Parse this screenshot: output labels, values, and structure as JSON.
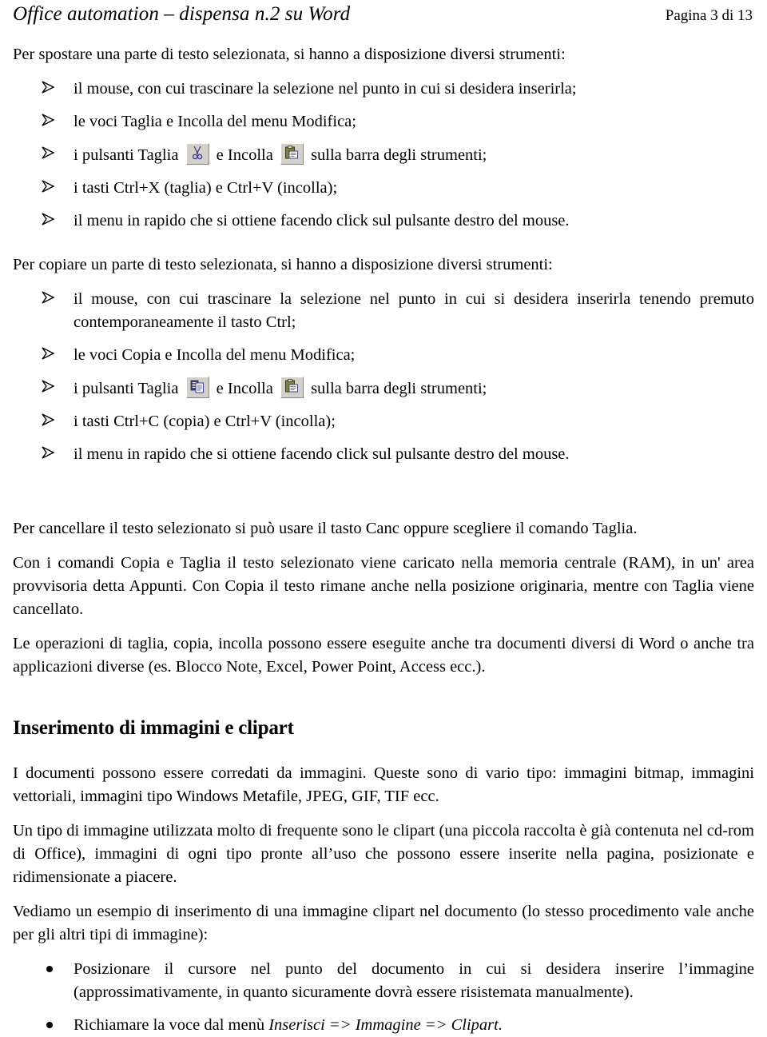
{
  "header": {
    "title": "Office automation – dispensa n.2 su Word",
    "page_label": "Pagina 3 di 13"
  },
  "content": {
    "intro_move": "Per spostare una parte di testo selezionata, si hanno a disposizione diversi strumenti:",
    "move_list": [
      {
        "text": "il mouse, con cui trascinare la selezione nel punto in cui si desidera inserirla;"
      },
      {
        "text": "le voci Taglia  e Incolla  del menu Modifica;"
      },
      {
        "prefix": "i pulsanti Taglia",
        "middle": "e Incolla",
        "suffix": "sulla barra degli strumenti;",
        "icon1": "cut-scissors-icon",
        "icon2": "paste-clipboard-icon"
      },
      {
        "text": "i tasti Ctrl+X  (taglia)  e Ctrl+V (incolla);"
      },
      {
        "text": "il menu in rapido che si ottiene facendo click sul pulsante destro del mouse."
      }
    ],
    "intro_copy": "Per copiare un parte di testo selezionata, si hanno a disposizione diversi strumenti:",
    "copy_list": [
      {
        "text": "il mouse, con cui trascinare la selezione nel punto in cui si desidera inserirla tenendo premuto contemporaneamente il tasto Ctrl;"
      },
      {
        "text": "le voci Copia  e Incolla  del menu Modifica;"
      },
      {
        "prefix": "i pulsanti Taglia",
        "middle": "e Incolla",
        "suffix": "sulla barra degli strumenti;",
        "icon1": "copy-documents-icon",
        "icon2": "paste-clipboard-icon"
      },
      {
        "text": "i tasti Ctrl+C  (copia)  e Ctrl+V (incolla);"
      },
      {
        "text": "il menu in rapido che si ottiene facendo click sul pulsante destro del mouse."
      }
    ],
    "para_delete": "Per cancellare il testo selezionato si può usare il tasto Canc oppure scegliere il comando Taglia.",
    "para_clipboard": "Con i comandi Copia e Taglia il testo selezionato viene caricato nella memoria centrale (RAM), in un' area provvisoria detta Appunti. Con Copia il testo rimane anche nella posizione originaria, mentre con Taglia viene cancellato.",
    "para_crossapp": "Le operazioni di taglia, copia, incolla possono essere eseguite anche tra documenti diversi di Word o anche tra applicazioni diverse (es. Blocco Note, Excel, Power Point, Access ecc.).",
    "heading_images": "Inserimento di immagini e clipart",
    "para_images_1": "I documenti possono essere corredati da immagini. Queste sono di vario tipo: immagini bitmap, immagini vettoriali, immagini tipo Windows Metafile, JPEG, GIF, TIF ecc.",
    "para_images_2": "Un tipo di immagine utilizzata molto di frequente sono le clipart (una piccola raccolta è già contenuta nel cd-rom di Office), immagini di ogni tipo pronte all’uso che possono essere inserite nella pagina, posizionate e ridimensionate a piacere.",
    "para_images_3": "Vediamo un esempio di inserimento di una immagine clipart nel documento (lo stesso procedimento vale anche per gli altri tipi di immagine):",
    "steps_list": [
      {
        "text": "Posizionare il cursore nel punto del documento in cui si desidera inserire l’immagine (approssimativamente, in quanto sicuramente dovrà essere risistemata manualmente)."
      },
      {
        "prefix": "Richiamare la voce dal menù",
        "menu_path": "Inserisci => Immagine => Clipart."
      }
    ]
  },
  "colors": {
    "text": "#000000",
    "page_background": "#ffffff",
    "icon_button_face": "#d4d0c8",
    "icon_accent_blue": "#3b3f8f",
    "icon_accent_white": "#ffffff",
    "icon_accent_olive": "#7f7f3f"
  }
}
